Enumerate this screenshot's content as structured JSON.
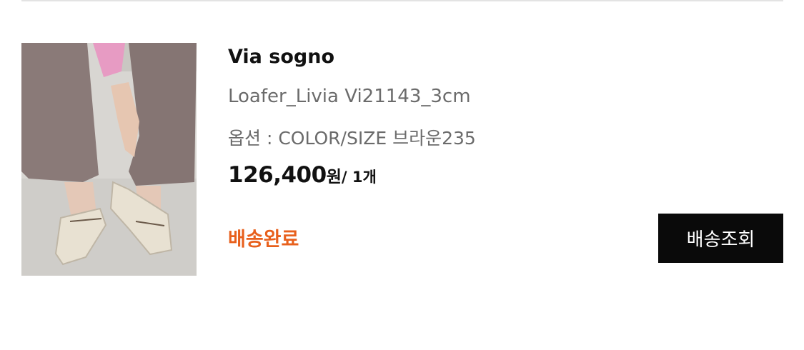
{
  "order_item": {
    "brand": "Via sogno",
    "product_name": "Loafer_Livia Vi21143_3cm",
    "option": "옵션 : COLOR/SIZE 브라운235",
    "price": {
      "amount": "126,400",
      "currency_unit": "원",
      "quantity": "/ 1개"
    },
    "status": "배송완료",
    "track_button_label": "배송조회"
  },
  "colors": {
    "status_accent": "#e8601c",
    "button_bg": "#0a0a0a",
    "button_text": "#ffffff",
    "secondary_text": "#6b6b6b"
  }
}
